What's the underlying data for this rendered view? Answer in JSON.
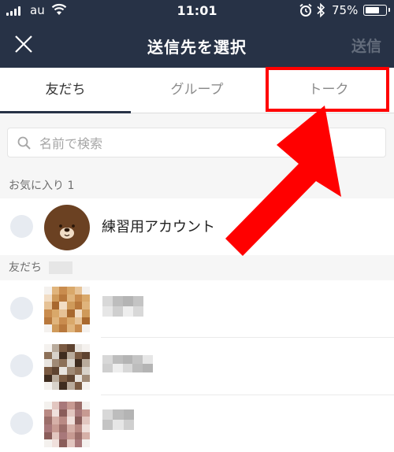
{
  "status": {
    "carrier": "au",
    "time": "11:01",
    "battery_pct": "75%",
    "battery_level": 0.75,
    "icons": [
      "signal-icon",
      "wifi-icon",
      "alarm-icon",
      "bluetooth-icon",
      "battery-icon"
    ]
  },
  "header": {
    "title": "送信先を選択",
    "send_label": "送信",
    "close_icon": "close-icon"
  },
  "tabs": [
    {
      "label": "友だち",
      "active": true
    },
    {
      "label": "グループ",
      "active": false
    },
    {
      "label": "トーク",
      "active": false
    }
  ],
  "search": {
    "placeholder": "名前で検索",
    "value": "",
    "icon": "search-icon"
  },
  "favorites": {
    "header": "お気に入り 1",
    "items": [
      {
        "name": "練習用アカウント",
        "avatar": "bear-avatar"
      }
    ]
  },
  "friends": {
    "header": "友だち",
    "items": [
      {
        "name": "",
        "avatar": "pixelated-avatar"
      },
      {
        "name": "",
        "avatar": "pixelated-avatar"
      },
      {
        "name": "",
        "avatar": "pixelated-avatar"
      }
    ]
  },
  "colors": {
    "header_bg": "#273246",
    "annotation": "#ff0000",
    "radio_bg": "#e7ebf1"
  }
}
